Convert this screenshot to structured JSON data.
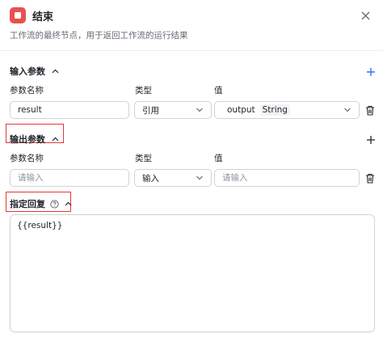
{
  "header": {
    "title": "结束",
    "description": "工作流的最终节点，用于返回工作流的运行结果"
  },
  "input_section": {
    "title": "输入参数",
    "columns": {
      "name": "参数名称",
      "type": "类型",
      "value": "值"
    },
    "row": {
      "name": "result",
      "type": "引用",
      "value_ref": "output",
      "value_type_tag": "String"
    }
  },
  "output_section": {
    "title": "输出参数",
    "columns": {
      "name": "参数名称",
      "type": "类型",
      "value": "值"
    },
    "row": {
      "name_placeholder": "请输入",
      "type": "输入",
      "value_placeholder": "请输入"
    }
  },
  "reply_section": {
    "title": "指定回复",
    "content": "{{result}}"
  },
  "colors": {
    "accent": "#3370ff",
    "node_icon": "#e8514f",
    "highlight_box": "#e53935"
  },
  "icons": {
    "close": "close-icon",
    "collapse": "chevron-up-icon",
    "add": "plus-icon",
    "dropdown": "chevron-down-icon",
    "delete": "trash-icon",
    "help": "question-circle-icon"
  }
}
